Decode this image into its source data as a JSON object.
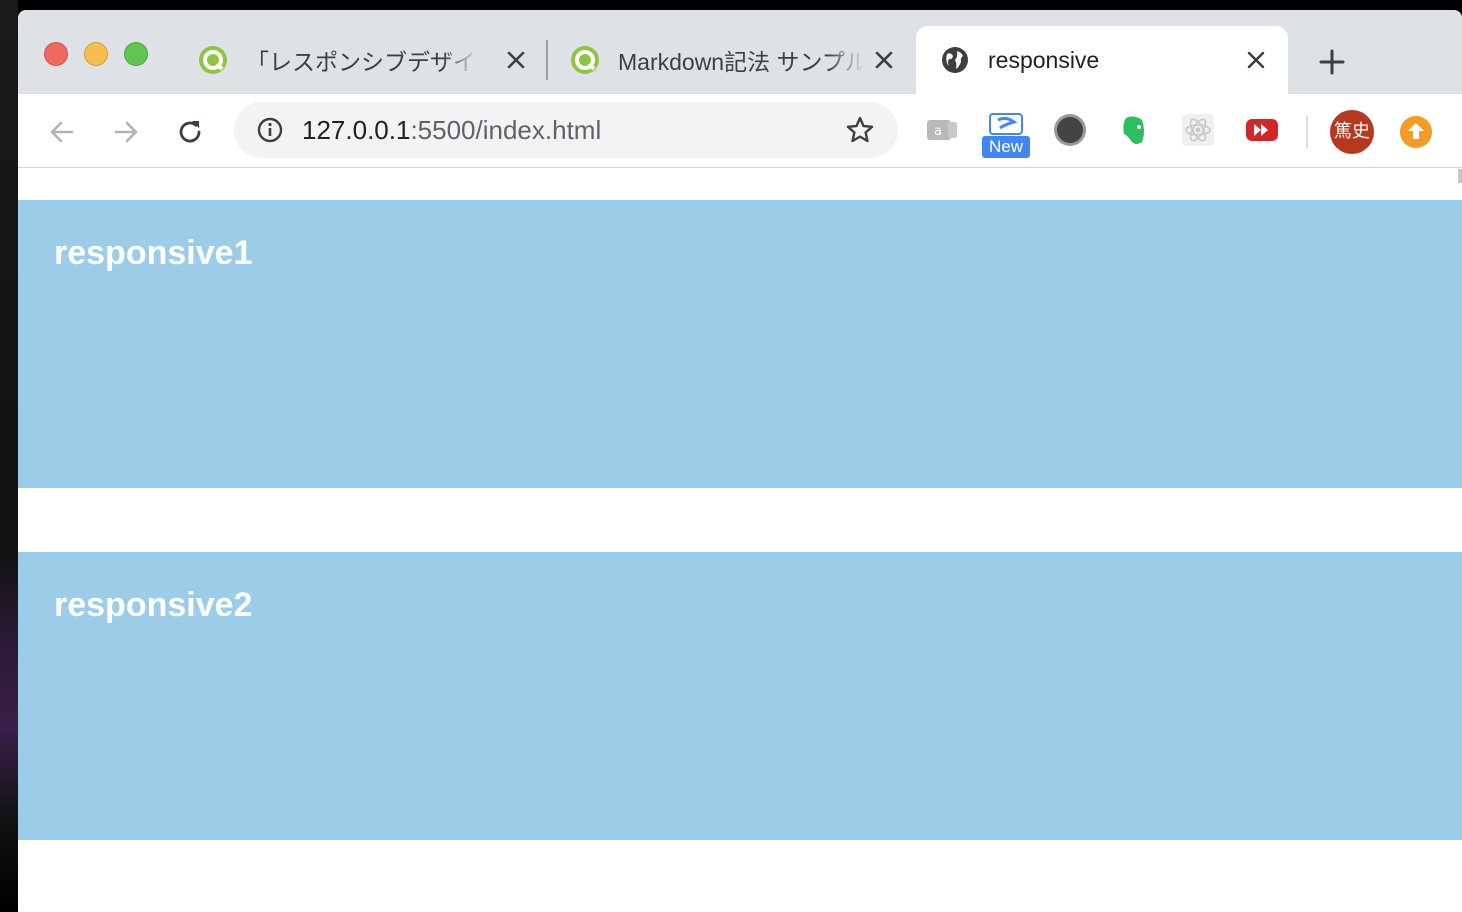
{
  "browser": {
    "tabs": [
      {
        "title": "「レスポンシブデザインとは",
        "favicon": "green-circle-icon",
        "active": false
      },
      {
        "title": "Markdown記法 サンプル集",
        "favicon": "green-circle-icon",
        "active": false
      },
      {
        "title": "responsive",
        "favicon": "globe-icon",
        "active": true
      }
    ],
    "url_host": "127.0.0.1",
    "url_rest": ":5500/index.html",
    "extensions": {
      "new_badge": "New",
      "avatar_text": "篤史"
    }
  },
  "page": {
    "sections": [
      {
        "heading": "responsive1"
      },
      {
        "heading": "responsive2"
      }
    ],
    "section_color": "#9bcce8",
    "heading_color": "#ffffff"
  }
}
